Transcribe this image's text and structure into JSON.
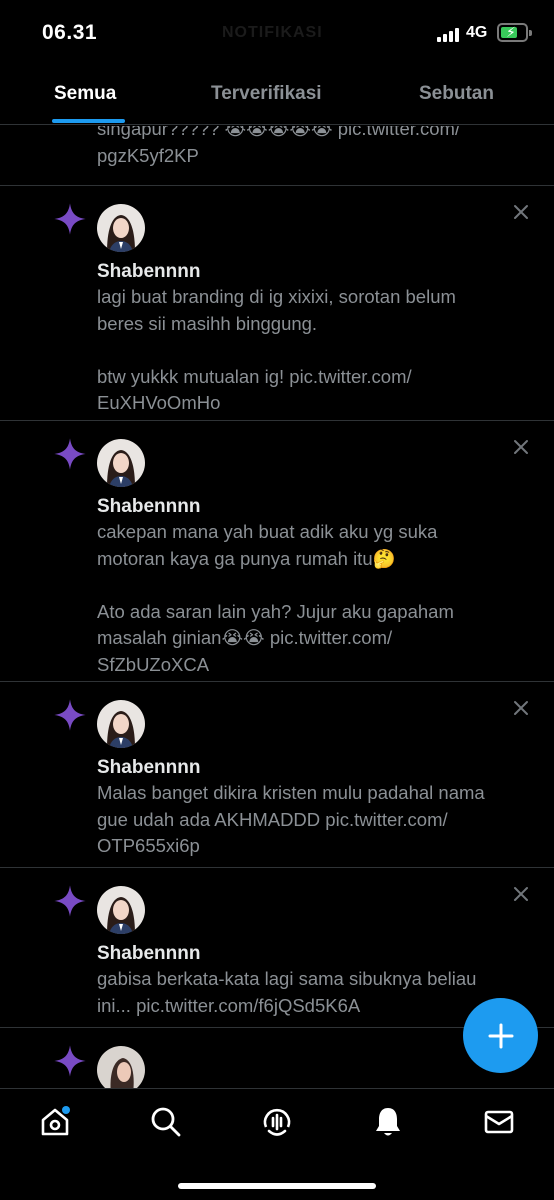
{
  "status_bar": {
    "time": "06.31",
    "faded_title": "NOTIFIKASI",
    "network": "4G"
  },
  "tabs": [
    {
      "label": "Semua",
      "active": true
    },
    {
      "label": "Terverifikasi",
      "active": false
    },
    {
      "label": "Sebutan",
      "active": false
    }
  ],
  "feed": {
    "partial_text": "singapur????? 😭😭😭😭😭 pic.twitter.com/\npgzK5yf2KP",
    "items": [
      {
        "author": "Shabennnn",
        "text": "lagi buat branding di ig xixixi, sorotan belum\nberes sii masihh binggung.\n\nbtw yukkk mutualan ig! pic.twitter.com/\nEuXHVoOmHo"
      },
      {
        "author": "Shabennnn",
        "text": "cakepan mana yah buat adik aku yg suka\nmotoran kaya ga punya rumah itu🤔\n\nAto ada saran lain yah? Jujur aku gapaham\nmasalah ginian😭😭 pic.twitter.com/\nSfZbUZoXCA"
      },
      {
        "author": "Shabennnn",
        "text": "Malas banget dikira kristen mulu padahal nama\ngue udah ada AKHMADDD pic.twitter.com/\nOTP655xi6p"
      },
      {
        "author": "Shabennnn",
        "text": "gabisa berkata-kata lagi sama sibuknya beliau\nini... pic.twitter.com/f6jQSd5K6A"
      }
    ]
  },
  "colors": {
    "accent": "#1d9bf0",
    "sparkle": "#794bc4",
    "muted_text": "#8b9095",
    "divider": "#2f3336"
  },
  "icons": {
    "sparkle": "sparkle-icon",
    "close": "close-icon",
    "compose": "plus-icon",
    "nav": [
      "home-icon",
      "search-icon",
      "spaces-icon",
      "bell-icon",
      "mail-icon"
    ]
  }
}
